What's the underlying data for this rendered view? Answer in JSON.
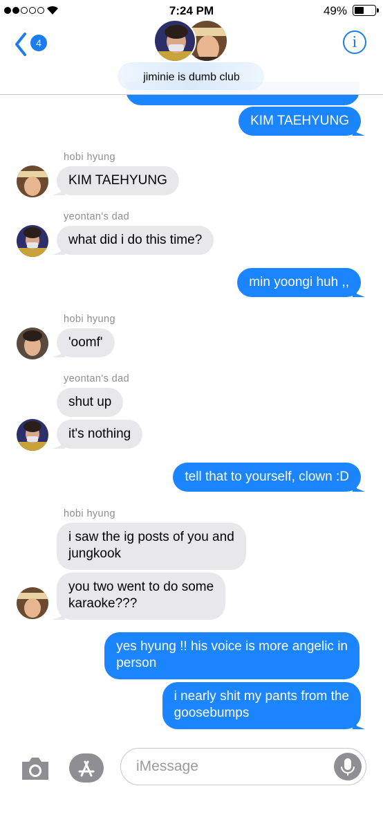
{
  "status": {
    "time": "7:24 PM",
    "battery": "49%"
  },
  "header": {
    "back_badge": "4",
    "group_name": "jiminie is dumb club",
    "info_label": "i"
  },
  "messages": [
    {
      "from": "me",
      "text": "KIM TAEHYUNG"
    },
    {
      "sender": "hobi hyung",
      "text": "KIM TAEHYUNG"
    },
    {
      "sender": "yeontan's dad",
      "text": "what did i do this time?"
    },
    {
      "from": "me",
      "text": "min yoongi huh ,,"
    },
    {
      "sender": "hobi hyung",
      "text": "'oomf'"
    },
    {
      "sender": "yeontan's dad",
      "text": "shut up"
    },
    {
      "text": "it's nothing"
    },
    {
      "from": "me",
      "text": "tell that to yourself, clown :D"
    },
    {
      "sender": "hobi hyung",
      "line1": "i saw the ig posts of you and",
      "line2": "jungkook"
    },
    {
      "line1": "you two went to do some",
      "line2": "karaoke???"
    },
    {
      "from": "me",
      "line1": "yes hyung !! his voice is more angelic in",
      "line2": "person"
    },
    {
      "from": "me",
      "line1": "i nearly shit my pants from the",
      "line2": "goosebumps"
    }
  ],
  "composer": {
    "placeholder": "iMessage"
  },
  "colors": {
    "accent": "#1b84ff",
    "incoming": "#e8e8ea",
    "sender_label": "#8e8e93"
  },
  "icons": [
    "back-chevron-icon",
    "info-icon",
    "camera-icon",
    "app-store-icon",
    "microphone-icon",
    "wifi-icon"
  ]
}
